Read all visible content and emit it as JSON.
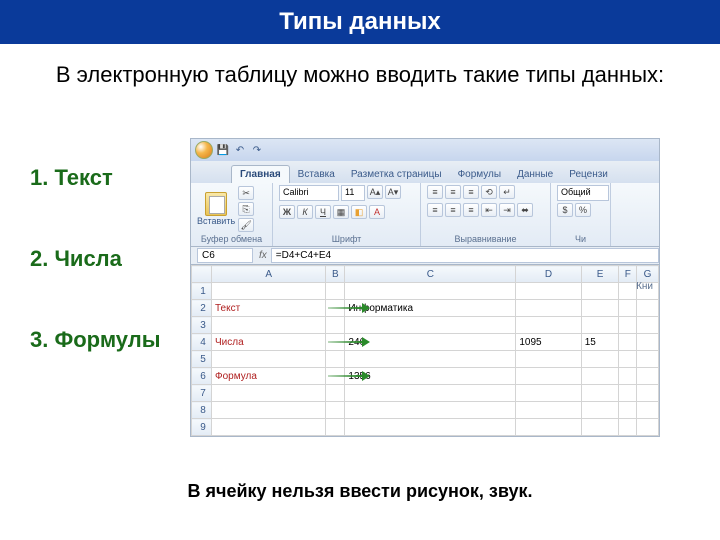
{
  "slide": {
    "title": "Типы данных",
    "subtitle": "В электронную таблицу можно вводить такие типы данных:",
    "items": [
      "1. Текст",
      "2. Числа",
      "3. Формулы"
    ],
    "footer": "В ячейку нельзя ввести рисунок, звук."
  },
  "excel": {
    "qat_hint": "Кни",
    "tabs": [
      "Главная",
      "Вставка",
      "Разметка страницы",
      "Формулы",
      "Данные",
      "Рецензи"
    ],
    "active_tab": 0,
    "groups": {
      "clipboard": {
        "label": "Буфер обмена",
        "paste": "Вставить"
      },
      "font": {
        "label": "Шрифт",
        "name": "Calibri",
        "size": "11",
        "bold": "Ж",
        "italic": "К",
        "underline": "Ч"
      },
      "align": {
        "label": "Выравнивание"
      },
      "number": {
        "label": "Чи",
        "format": "Общий"
      }
    },
    "name_box": "C6",
    "formula": "=D4+C4+E4",
    "columns": [
      "A",
      "B",
      "C",
      "D",
      "E",
      "F",
      "G"
    ],
    "rows": [
      {
        "n": "1",
        "cells": [
          "",
          "",
          "",
          "",
          "",
          "",
          ""
        ]
      },
      {
        "n": "2",
        "cells": [
          "Текст",
          "",
          "Информатика",
          "",
          "",
          "",
          ""
        ],
        "red": true,
        "arrow": true
      },
      {
        "n": "3",
        "cells": [
          "",
          "",
          "",
          "",
          "",
          "",
          ""
        ]
      },
      {
        "n": "4",
        "cells": [
          "Числа",
          "",
          "246",
          "1095",
          "15",
          "",
          ""
        ],
        "red": true,
        "arrow": true,
        "nums": [
          2,
          3,
          4
        ]
      },
      {
        "n": "5",
        "cells": [
          "",
          "",
          "",
          "",
          "",
          "",
          ""
        ]
      },
      {
        "n": "6",
        "cells": [
          "Формула",
          "",
          "1356",
          "",
          "",
          "",
          ""
        ],
        "red": true,
        "arrow": true,
        "nums": [
          2
        ]
      },
      {
        "n": "7",
        "cells": [
          "",
          "",
          "",
          "",
          "",
          "",
          ""
        ]
      },
      {
        "n": "8",
        "cells": [
          "",
          "",
          "",
          "",
          "",
          "",
          ""
        ]
      },
      {
        "n": "9",
        "cells": [
          "",
          "",
          "",
          "",
          "",
          "",
          ""
        ]
      }
    ]
  }
}
